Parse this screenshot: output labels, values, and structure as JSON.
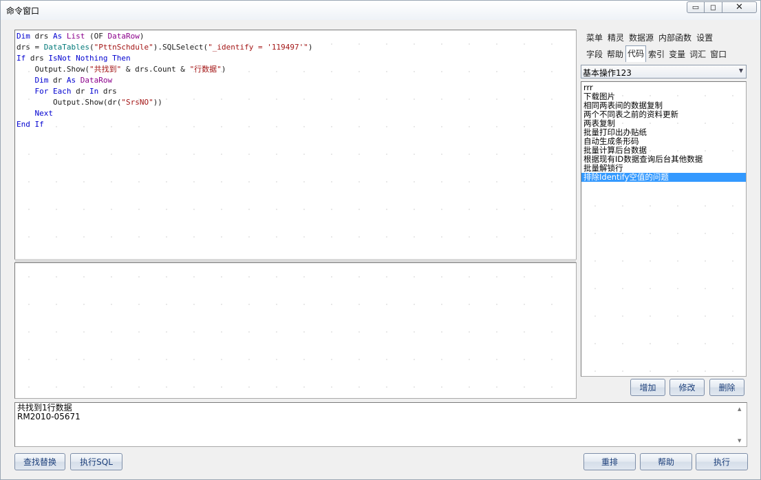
{
  "window": {
    "title": "命令窗口",
    "min_glyph": "▭",
    "max_glyph": "◻",
    "close_glyph": "✕"
  },
  "editor": {
    "lines": [
      [
        {
          "t": "Dim",
          "c": "kw"
        },
        {
          "t": " drs "
        },
        {
          "t": "As",
          "c": "kw"
        },
        {
          "t": " "
        },
        {
          "t": "List",
          "c": "ty"
        },
        {
          "t": " (OF "
        },
        {
          "t": "DataRow",
          "c": "ty"
        },
        {
          "t": ")"
        }
      ],
      [
        {
          "t": "drs = "
        },
        {
          "t": "DataTables",
          "c": "ob"
        },
        {
          "t": "("
        },
        {
          "t": "\"PttnSchdule\"",
          "c": "st"
        },
        {
          "t": ").SQLSelect("
        },
        {
          "t": "\"_identify = '119497'\"",
          "c": "st"
        },
        {
          "t": ")"
        }
      ],
      [
        {
          "t": "If",
          "c": "kw"
        },
        {
          "t": " drs "
        },
        {
          "t": "IsNot",
          "c": "kw"
        },
        {
          "t": " "
        },
        {
          "t": "Nothing",
          "c": "kw"
        },
        {
          "t": " "
        },
        {
          "t": "Then",
          "c": "kw"
        }
      ],
      [
        {
          "t": "    Output.Show("
        },
        {
          "t": "\"共找到\"",
          "c": "st"
        },
        {
          "t": " & drs.Count & "
        },
        {
          "t": "\"行数据\"",
          "c": "st"
        },
        {
          "t": ")"
        }
      ],
      [
        {
          "t": "    "
        },
        {
          "t": "Dim",
          "c": "kw"
        },
        {
          "t": " dr "
        },
        {
          "t": "As",
          "c": "kw"
        },
        {
          "t": " "
        },
        {
          "t": "DataRow",
          "c": "ty"
        }
      ],
      [
        {
          "t": "    "
        },
        {
          "t": "For",
          "c": "kw"
        },
        {
          "t": " "
        },
        {
          "t": "Each",
          "c": "kw"
        },
        {
          "t": " dr "
        },
        {
          "t": "In",
          "c": "kw"
        },
        {
          "t": " drs"
        }
      ],
      [
        {
          "t": "        Output.Show(dr("
        },
        {
          "t": "\"SrsNO\"",
          "c": "st"
        },
        {
          "t": "))"
        }
      ],
      [
        {
          "t": "    "
        },
        {
          "t": "Next",
          "c": "kw"
        }
      ],
      [
        {
          "t": "End",
          "c": "kw"
        },
        {
          "t": " "
        },
        {
          "t": "If",
          "c": "kw"
        }
      ]
    ]
  },
  "side": {
    "menu": [
      "菜单",
      "精灵",
      "数据源",
      "内部函数",
      "设置"
    ],
    "tabs": [
      "字段",
      "帮助",
      "代码",
      "索引",
      "变量",
      "词汇",
      "窗口"
    ],
    "active_tab": "代码",
    "combo_value": "基本操作123",
    "items": [
      "rrr",
      "下载图片",
      "相同两表间的数据复制",
      "两个不同表之前的资料更新",
      "两表复制",
      "批量打印出办贴纸",
      "自动生成条形码",
      "批量计算后台数据",
      "根据现有ID数据查询后台其他数据",
      "批量解锁行",
      "排除Identify空值的问题"
    ],
    "selected_index": 10,
    "add_label": "增加",
    "edit_label": "修改",
    "delete_label": "删除"
  },
  "output": {
    "lines": [
      "共找到1行数据",
      "RM2010-05671"
    ]
  },
  "bottom": {
    "find_replace_label": "查找替换",
    "exec_sql_label": "执行SQL",
    "reorder_label": "重排",
    "help_label": "帮助",
    "run_label": "执行"
  }
}
